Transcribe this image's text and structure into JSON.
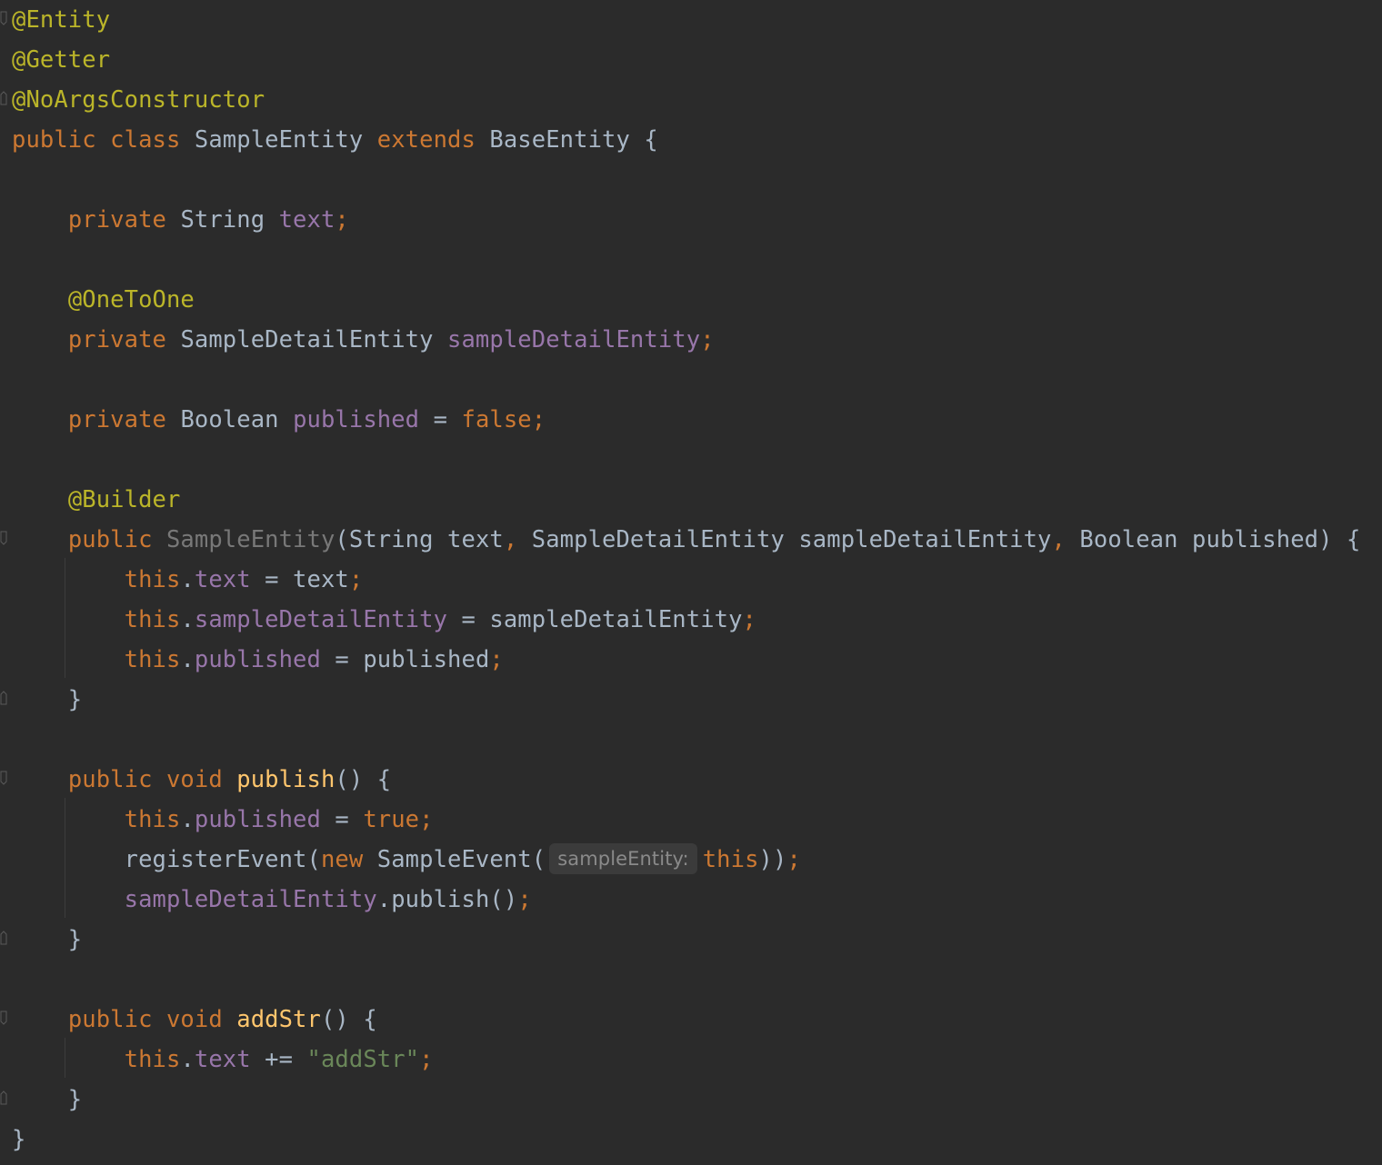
{
  "colors": {
    "background": "#2b2b2b",
    "keyword": "#cc7832",
    "annotation": "#bbb529",
    "field": "#9876aa",
    "method": "#ffc66d",
    "string": "#6a8759",
    "text": "#a9b7c6",
    "unused": "#787878",
    "hint_background": "#3b3b3b"
  },
  "code_lines": [
    {
      "tokens": [
        {
          "t": "@Entity",
          "c": "ann"
        }
      ]
    },
    {
      "tokens": [
        {
          "t": "@Getter",
          "c": "ann"
        }
      ]
    },
    {
      "tokens": [
        {
          "t": "@NoArgsConstructor",
          "c": "ann"
        }
      ]
    },
    {
      "tokens": [
        {
          "t": "public ",
          "c": "kw"
        },
        {
          "t": "class ",
          "c": "kw"
        },
        {
          "t": "SampleEntity ",
          "c": "plain"
        },
        {
          "t": "extends ",
          "c": "kw"
        },
        {
          "t": "BaseEntity {",
          "c": "plain"
        }
      ]
    },
    {
      "tokens": []
    },
    {
      "tokens": [
        {
          "t": "    ",
          "c": "plain"
        },
        {
          "t": "private ",
          "c": "kw"
        },
        {
          "t": "String ",
          "c": "plain"
        },
        {
          "t": "text",
          "c": "field"
        },
        {
          "t": ";",
          "c": "punc"
        }
      ]
    },
    {
      "tokens": []
    },
    {
      "tokens": [
        {
          "t": "    ",
          "c": "plain"
        },
        {
          "t": "@OneToOne",
          "c": "ann"
        }
      ]
    },
    {
      "tokens": [
        {
          "t": "    ",
          "c": "plain"
        },
        {
          "t": "private ",
          "c": "kw"
        },
        {
          "t": "SampleDetailEntity ",
          "c": "plain"
        },
        {
          "t": "sampleDetailEntity",
          "c": "field"
        },
        {
          "t": ";",
          "c": "punc"
        }
      ]
    },
    {
      "tokens": []
    },
    {
      "tokens": [
        {
          "t": "    ",
          "c": "plain"
        },
        {
          "t": "private ",
          "c": "kw"
        },
        {
          "t": "Boolean ",
          "c": "plain"
        },
        {
          "t": "published",
          "c": "field"
        },
        {
          "t": " = ",
          "c": "plain"
        },
        {
          "t": "false",
          "c": "kw"
        },
        {
          "t": ";",
          "c": "punc"
        }
      ]
    },
    {
      "tokens": []
    },
    {
      "tokens": [
        {
          "t": "    ",
          "c": "plain"
        },
        {
          "t": "@Builder",
          "c": "ann"
        }
      ]
    },
    {
      "tokens": [
        {
          "t": "    ",
          "c": "plain"
        },
        {
          "t": "public ",
          "c": "kw"
        },
        {
          "t": "SampleEntity",
          "c": "dim"
        },
        {
          "t": "(String text",
          "c": "plain"
        },
        {
          "t": ", ",
          "c": "punc"
        },
        {
          "t": "SampleDetailEntity sampleDetailEntity",
          "c": "plain"
        },
        {
          "t": ", ",
          "c": "punc"
        },
        {
          "t": "Boolean published) {",
          "c": "plain"
        }
      ]
    },
    {
      "tokens": [
        {
          "t": "        ",
          "c": "plain"
        },
        {
          "t": "this",
          "c": "kw"
        },
        {
          "t": ".",
          "c": "plain"
        },
        {
          "t": "text",
          "c": "field"
        },
        {
          "t": " = text",
          "c": "plain"
        },
        {
          "t": ";",
          "c": "punc"
        }
      ]
    },
    {
      "tokens": [
        {
          "t": "        ",
          "c": "plain"
        },
        {
          "t": "this",
          "c": "kw"
        },
        {
          "t": ".",
          "c": "plain"
        },
        {
          "t": "sampleDetailEntity",
          "c": "field"
        },
        {
          "t": " = sampleDetailEntity",
          "c": "plain"
        },
        {
          "t": ";",
          "c": "punc"
        }
      ]
    },
    {
      "tokens": [
        {
          "t": "        ",
          "c": "plain"
        },
        {
          "t": "this",
          "c": "kw"
        },
        {
          "t": ".",
          "c": "plain"
        },
        {
          "t": "published",
          "c": "field"
        },
        {
          "t": " = published",
          "c": "plain"
        },
        {
          "t": ";",
          "c": "punc"
        }
      ]
    },
    {
      "tokens": [
        {
          "t": "    }",
          "c": "plain"
        }
      ]
    },
    {
      "tokens": []
    },
    {
      "tokens": [
        {
          "t": "    ",
          "c": "plain"
        },
        {
          "t": "public ",
          "c": "kw"
        },
        {
          "t": "void ",
          "c": "kw"
        },
        {
          "t": "publish",
          "c": "fn"
        },
        {
          "t": "() {",
          "c": "plain"
        }
      ]
    },
    {
      "tokens": [
        {
          "t": "        ",
          "c": "plain"
        },
        {
          "t": "this",
          "c": "kw"
        },
        {
          "t": ".",
          "c": "plain"
        },
        {
          "t": "published",
          "c": "field"
        },
        {
          "t": " = ",
          "c": "plain"
        },
        {
          "t": "true",
          "c": "kw"
        },
        {
          "t": ";",
          "c": "punc"
        }
      ]
    },
    {
      "tokens": [
        {
          "t": "        registerEvent(",
          "c": "plain"
        },
        {
          "t": "new ",
          "c": "kw"
        },
        {
          "t": "SampleEvent(",
          "c": "plain"
        },
        {
          "t": "sampleEntity:",
          "c": "hint"
        },
        {
          "t": "this",
          "c": "kw"
        },
        {
          "t": "))",
          "c": "plain"
        },
        {
          "t": ";",
          "c": "punc"
        }
      ]
    },
    {
      "tokens": [
        {
          "t": "        ",
          "c": "plain"
        },
        {
          "t": "sampleDetailEntity",
          "c": "field"
        },
        {
          "t": ".publish()",
          "c": "plain"
        },
        {
          "t": ";",
          "c": "punc"
        }
      ]
    },
    {
      "tokens": [
        {
          "t": "    }",
          "c": "plain"
        }
      ]
    },
    {
      "tokens": []
    },
    {
      "tokens": [
        {
          "t": "    ",
          "c": "plain"
        },
        {
          "t": "public ",
          "c": "kw"
        },
        {
          "t": "void ",
          "c": "kw"
        },
        {
          "t": "addStr",
          "c": "fn"
        },
        {
          "t": "() {",
          "c": "plain"
        }
      ]
    },
    {
      "tokens": [
        {
          "t": "        ",
          "c": "plain"
        },
        {
          "t": "this",
          "c": "kw"
        },
        {
          "t": ".",
          "c": "plain"
        },
        {
          "t": "text",
          "c": "field"
        },
        {
          "t": " += ",
          "c": "plain"
        },
        {
          "t": "\"addStr\"",
          "c": "str"
        },
        {
          "t": ";",
          "c": "punc"
        }
      ]
    },
    {
      "tokens": [
        {
          "t": "    }",
          "c": "plain"
        }
      ]
    },
    {
      "tokens": [
        {
          "t": "}",
          "c": "plain"
        }
      ]
    }
  ]
}
